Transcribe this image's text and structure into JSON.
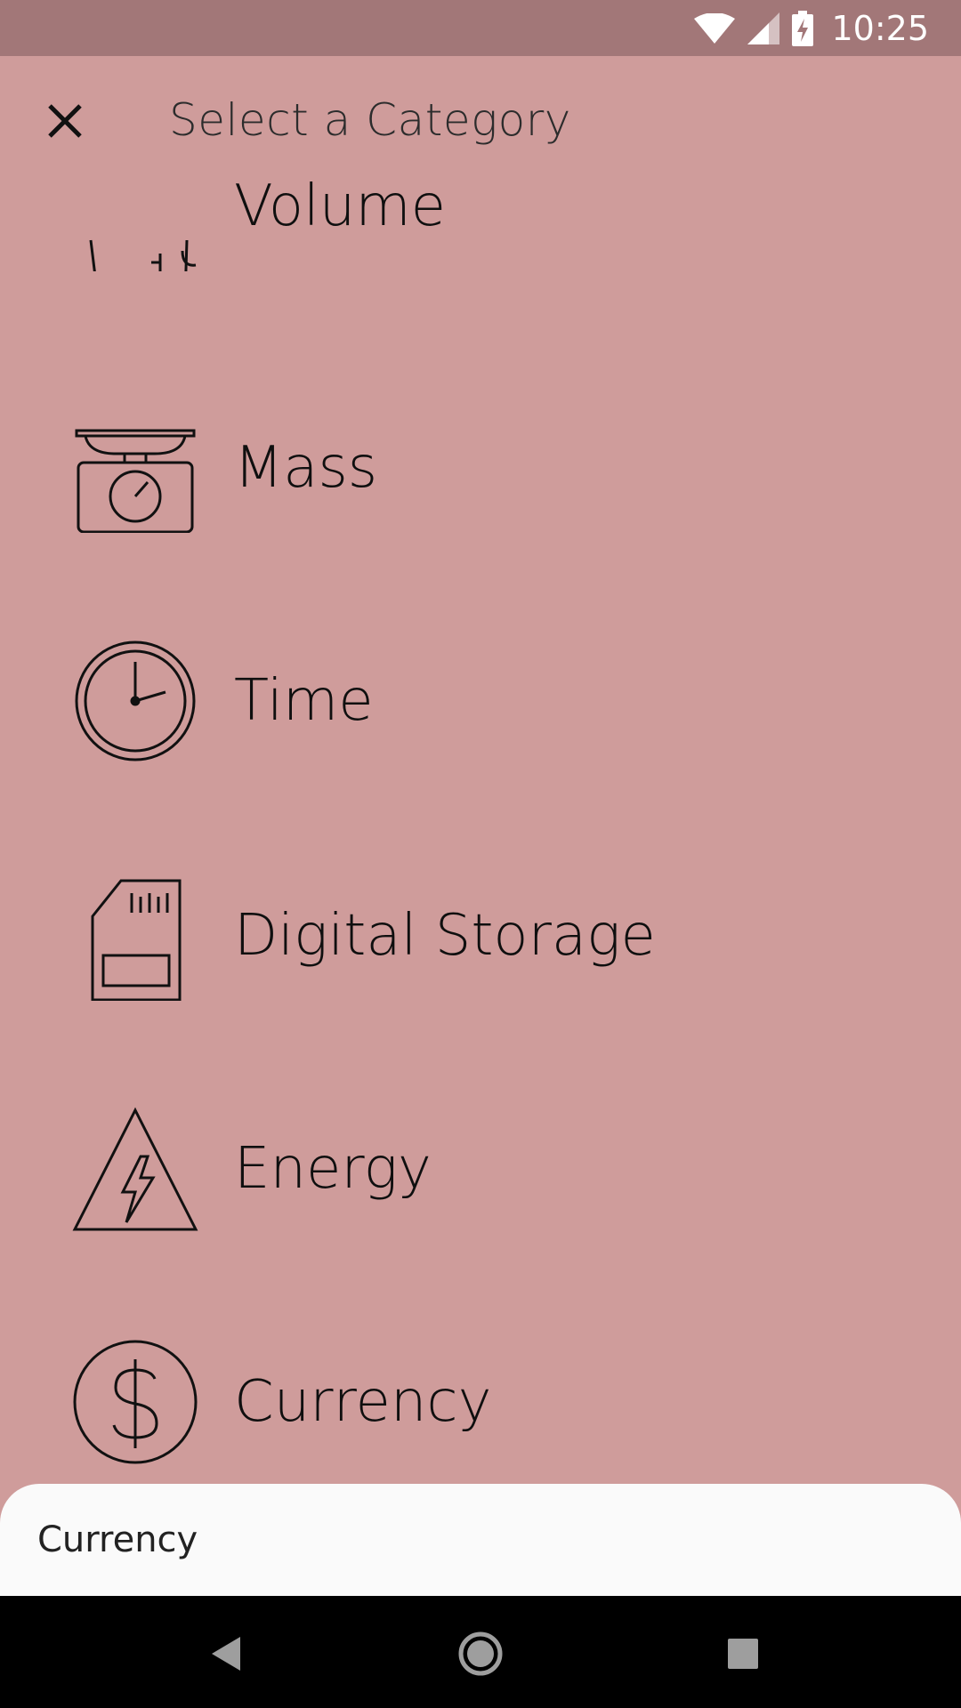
{
  "status_bar": {
    "time": "10:25"
  },
  "header": {
    "title": "Select a Category"
  },
  "categories": [
    {
      "label": "Volume",
      "icon": "measuring-cup-icon"
    },
    {
      "label": "Mass",
      "icon": "kitchen-scale-icon"
    },
    {
      "label": "Time",
      "icon": "clock-icon"
    },
    {
      "label": "Digital Storage",
      "icon": "sd-card-icon"
    },
    {
      "label": "Energy",
      "icon": "high-voltage-icon"
    },
    {
      "label": "Currency",
      "icon": "dollar-coin-icon"
    }
  ],
  "bottom_sheet": {
    "label": "Currency"
  },
  "colors": {
    "background": "#cf9c9b",
    "status_bar": "#a27778",
    "sheet": "#fafafa",
    "nav_bar": "#000000"
  }
}
